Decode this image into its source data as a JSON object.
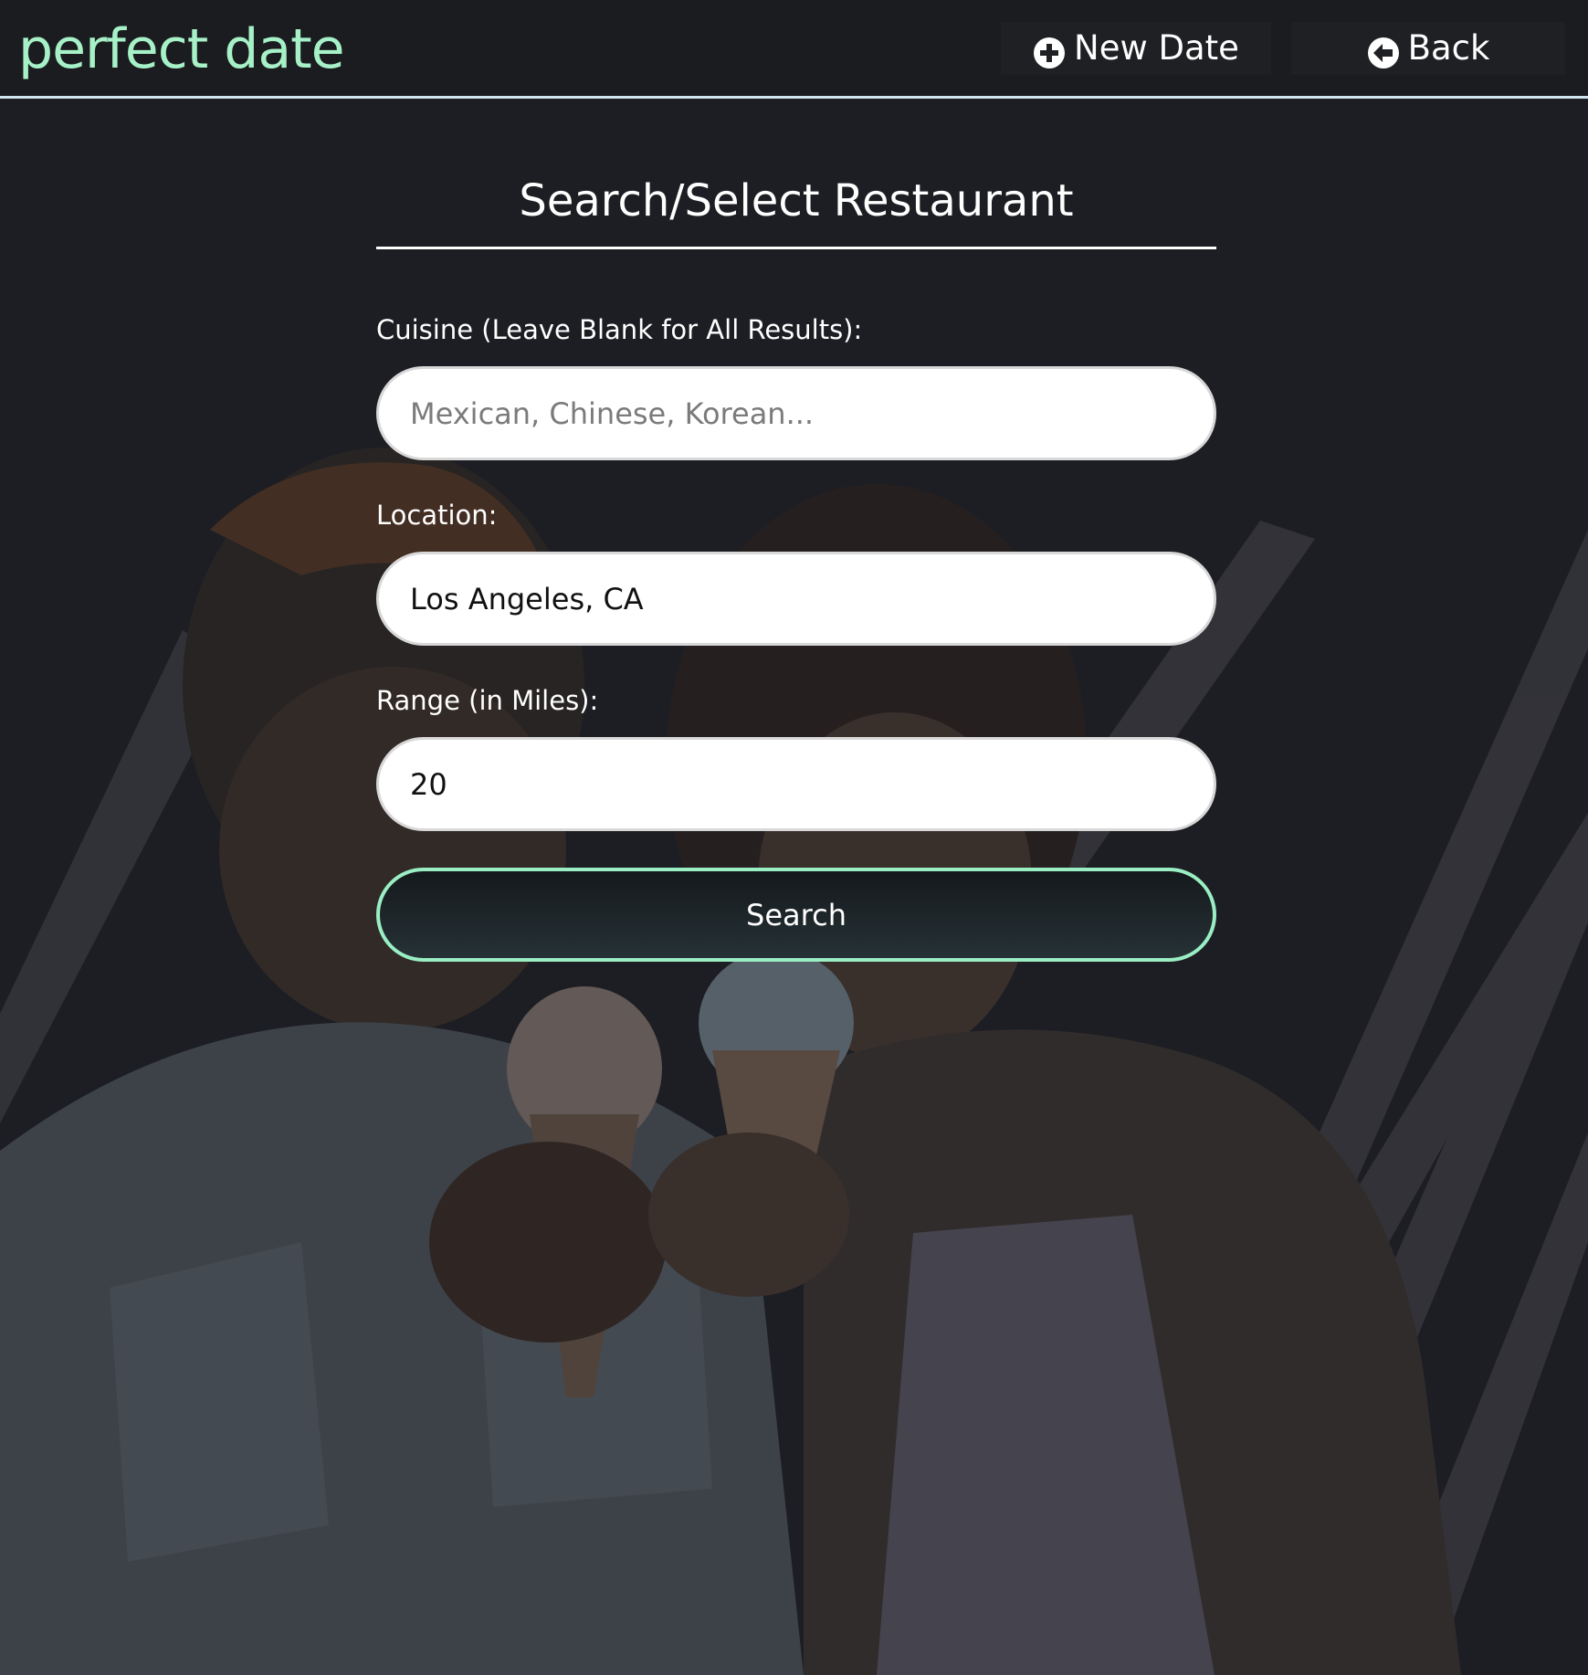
{
  "nav": {
    "brand": "perfect date",
    "new_date_label": "New Date",
    "back_label": "Back"
  },
  "form": {
    "title": "Search/Select Restaurant",
    "cuisine": {
      "label": "Cuisine (Leave Blank for All Results):",
      "placeholder": "Mexican, Chinese, Korean...",
      "value": ""
    },
    "location": {
      "label": "Location:",
      "value": "Los Angeles, CA"
    },
    "range": {
      "label": "Range (in Miles):",
      "value": "20"
    },
    "search_label": "Search"
  },
  "colors": {
    "brand": "#a6f1c7",
    "accent": "#9aeec4",
    "nav_border": "#cfe6f1",
    "background": "#1f2023"
  },
  "icons": {
    "new_date": "plus-circle-icon",
    "back": "arrow-left-circle-icon"
  }
}
